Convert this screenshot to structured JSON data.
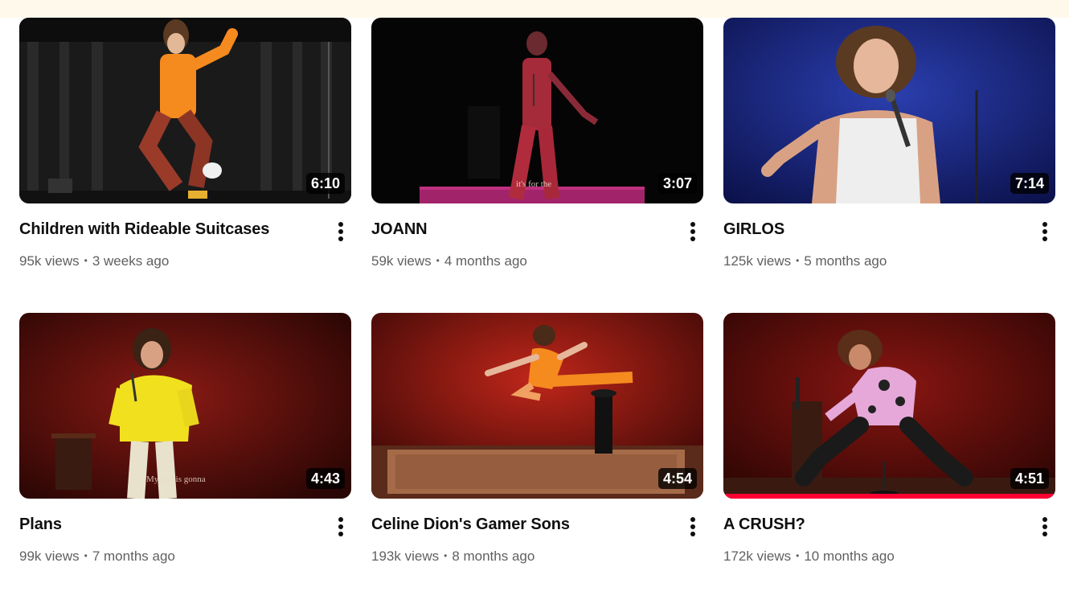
{
  "videos": [
    {
      "title": "Children with Rideable Suitcases",
      "views": "95k views",
      "age": "3 weeks ago",
      "duration": "6:10"
    },
    {
      "title": "JOANN",
      "views": "59k views",
      "age": "4 months ago",
      "duration": "3:07",
      "caption": "it's for the"
    },
    {
      "title": "GIRLOS",
      "views": "125k views",
      "age": "5 months ago",
      "duration": "7:14"
    },
    {
      "title": "Plans",
      "views": "99k views",
      "age": "7 months ago",
      "duration": "4:43",
      "caption": "My dad is gonna"
    },
    {
      "title": "Celine Dion's Gamer Sons",
      "views": "193k views",
      "age": "8 months ago",
      "duration": "4:54"
    },
    {
      "title": "A CRUSH?",
      "views": "172k views",
      "age": "10 months ago",
      "duration": "4:51"
    }
  ],
  "separator": "•",
  "colors": {
    "title": "#0f0f0f",
    "stats": "#606060",
    "top_strip": "#fef9ea",
    "progress_red": "#ff0033"
  }
}
